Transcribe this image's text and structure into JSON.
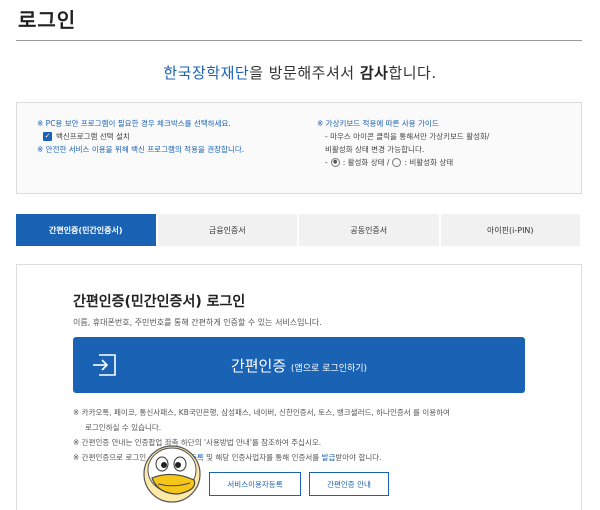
{
  "header": {
    "title": "로그인"
  },
  "welcome": {
    "org": "한국장학재단",
    "middle": "을 방문해주셔서 ",
    "thanks": "감사",
    "end": "합니다."
  },
  "notice": {
    "left": {
      "line1": "※ PC용 보안 프로그램이 필요한 경우 체크박스를 선택하세요.",
      "checkbox_label": "백신프로그램 선택 설치",
      "checkbox_checked": true,
      "line3": "※ 안전한 서비스 이용을 위해 백신 프로그램의 적용을 권장합니다."
    },
    "right": {
      "title": "※ 가상키보드 적용에 따른 사용 가이드",
      "line1": "- 마우스 아이콘 클릭을 통해서만 가상키보드 활성화/",
      "line2": "비활성화 상태 변경 가능합니다.",
      "state_dash": "-",
      "active_label": ": 활성화 상태 /",
      "inactive_label": ": 비활성화 상태"
    }
  },
  "tabs": [
    {
      "label": "간편인증(민간인증서)",
      "active": true
    },
    {
      "label": "금융인증서",
      "active": false
    },
    {
      "label": "공동인증서",
      "active": false
    },
    {
      "label": "아이핀(i-PIN)",
      "active": false
    }
  ],
  "panel": {
    "title": "간편인증(민간인증서) 로그인",
    "description": "이름, 휴대폰번호, 주민번호를 통해 간편하게 인증할 수 있는 서비스입니다.",
    "button_main": "간편인증",
    "button_sub": "(앱으로 로그인하기)",
    "notes": {
      "n1": "※ 카카오톡, 페이코, 통신사패스, KB국민은행, 삼성패스, 네이버, 신한인증서, 토스, 뱅크샐러드, 하나인증서 를 이용하여",
      "n1b": "로그인하실 수 있습니다.",
      "n2": "※ 간편인증 안내는 인증팝업 좌측 하단의 '사용방법 안내'를 참조하여 주십시오.",
      "n3a": "※ 간편인증으로 로그인 ",
      "n3link1": "서비스이용자등록",
      "n3b": " 및 해당 인증사업자를 통해 인증서를 ",
      "n3link2": "발급",
      "n3c": "받아야 합니다."
    },
    "footer": {
      "register_label": "서비스이용자등록",
      "guide_label": "간편인증 안내"
    }
  },
  "colors": {
    "accent": "#1a62b4",
    "tab_inactive": "#f1f1f1",
    "mascot_yellow": "#f5c518"
  }
}
